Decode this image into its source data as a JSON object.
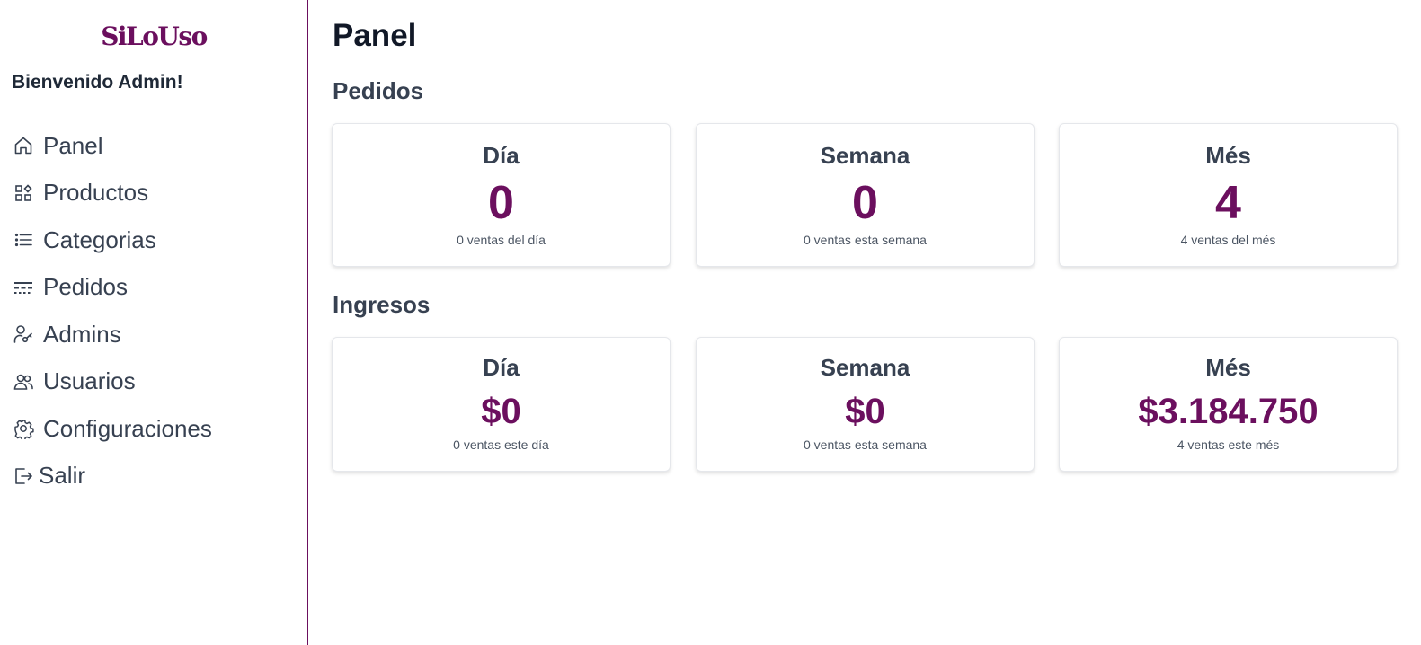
{
  "sidebar": {
    "logo": "SiLoUso",
    "welcome": "Bienvenido Admin!",
    "items": [
      {
        "label": "Panel",
        "icon": "home-icon"
      },
      {
        "label": "Productos",
        "icon": "products-grid-icon"
      },
      {
        "label": "Categorias",
        "icon": "list-icon"
      },
      {
        "label": "Pedidos",
        "icon": "orders-icon"
      },
      {
        "label": "Admins",
        "icon": "admin-user-key-icon"
      },
      {
        "label": "Usuarios",
        "icon": "users-icon"
      },
      {
        "label": "Configuraciones",
        "icon": "gear-icon"
      },
      {
        "label": "Salir",
        "icon": "logout-icon"
      }
    ]
  },
  "main": {
    "title": "Panel",
    "pedidos": {
      "title": "Pedidos",
      "cards": [
        {
          "label": "Día",
          "value": "0",
          "sub": "0 ventas del día"
        },
        {
          "label": "Semana",
          "value": "0",
          "sub": "0 ventas esta semana"
        },
        {
          "label": "Més",
          "value": "4",
          "sub": "4 ventas del més"
        }
      ]
    },
    "ingresos": {
      "title": "Ingresos",
      "cards": [
        {
          "label": "Día",
          "value": "$0",
          "sub": "0 ventas este día"
        },
        {
          "label": "Semana",
          "value": "$0",
          "sub": "0 ventas esta semana"
        },
        {
          "label": "Més",
          "value": "$3.184.750",
          "sub": "4 ventas este més"
        }
      ]
    }
  },
  "colors": {
    "accent": "#6b0f5e",
    "text": "#374151",
    "heading": "#111827"
  }
}
